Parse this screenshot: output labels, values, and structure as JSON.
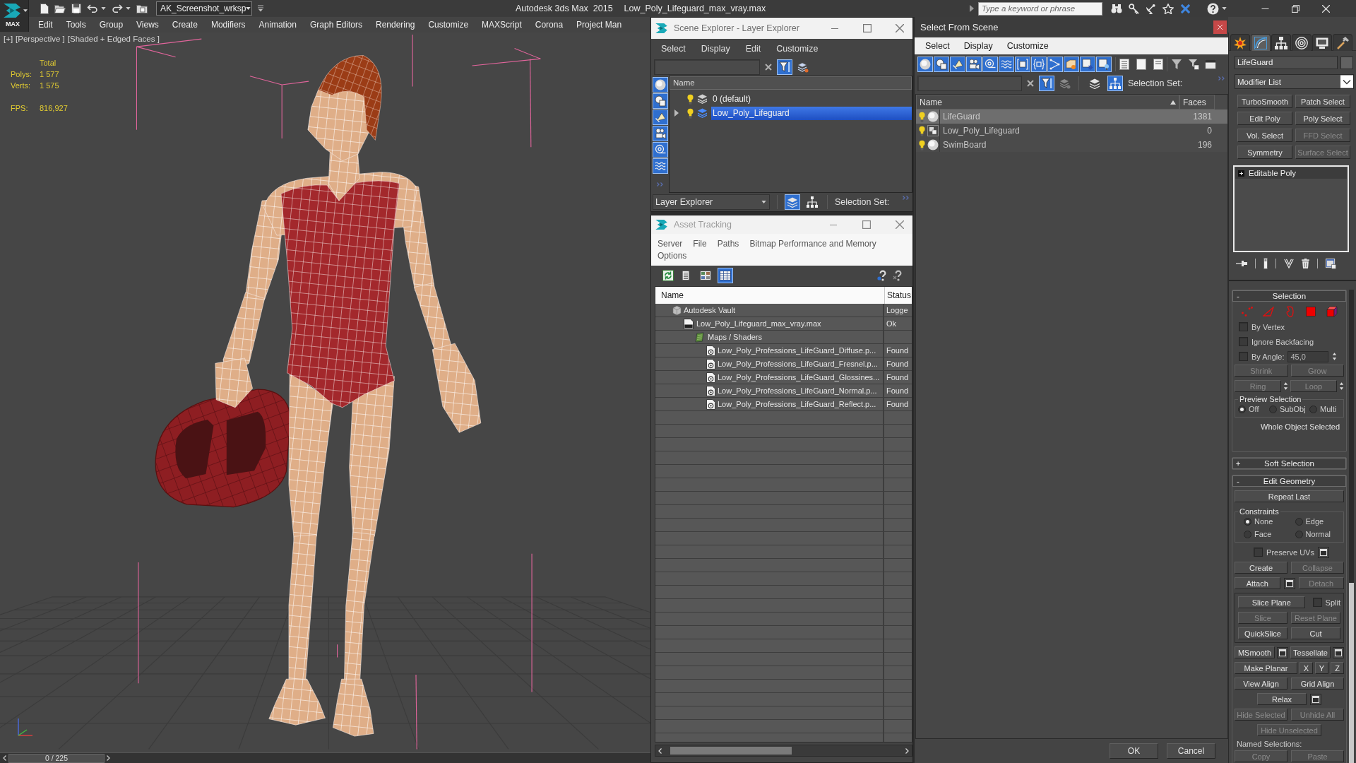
{
  "app_button": {
    "label": "MAX"
  },
  "title_bar": {
    "workspace": "AK_Screenshot_wrksp",
    "app_title": "Autodesk 3ds Max  2015",
    "file_name": "Low_Poly_Lifeguard_max_vray.max",
    "search": {
      "placeholder": "Type a keyword or phrase"
    }
  },
  "menu_bar": [
    "Edit",
    "Tools",
    "Group",
    "Views",
    "Create",
    "Modifiers",
    "Animation",
    "Graph Editors",
    "Rendering",
    "Customize",
    "MAXScript",
    "Corona",
    "Project Man"
  ],
  "viewport": {
    "labels": [
      "[+]",
      "[Perspective ]",
      "[Shaded + Edged Faces ]"
    ],
    "stats": {
      "heading": "Total",
      "rows": [
        {
          "label": "Polys:",
          "value": "1 577"
        },
        {
          "label": "Verts:",
          "value": "1 575"
        }
      ]
    },
    "fps": {
      "label": "FPS:",
      "value": "816,927"
    }
  },
  "time_slider": {
    "label": "0 / 225",
    "level": 0
  },
  "scene_explorer": {
    "title": "Scene Explorer - Layer Explorer",
    "menu": [
      "Select",
      "Display",
      "Edit",
      "Customize"
    ],
    "filter_toggle": {
      "on": true
    },
    "filters": [
      {
        "kind": "geometry",
        "on": true
      },
      {
        "kind": "shape",
        "on": true
      },
      {
        "kind": "light",
        "on": true
      },
      {
        "kind": "camera",
        "on": true
      },
      {
        "kind": "helper",
        "on": true
      },
      {
        "kind": "spacewarp",
        "on": true
      }
    ],
    "column": "Name",
    "layers": [
      {
        "name": "0 (default)",
        "visible": true,
        "selected": false,
        "expandable": false
      },
      {
        "name": "Low_Poly_Lifeguard",
        "visible": true,
        "selected": true,
        "expandable": true
      }
    ],
    "mode": "Layer Explorer",
    "views": [
      {
        "kind": "layers",
        "selected": true
      },
      {
        "kind": "hierarchy",
        "selected": false
      }
    ],
    "selection_set": "Selection Set:"
  },
  "asset_tracking": {
    "title": "Asset Tracking",
    "menu": [
      "Server",
      "File",
      "Paths",
      "Bitmap Performance and Memory",
      "Options"
    ],
    "views": [
      {
        "kind": "list",
        "selected": false
      },
      {
        "kind": "thumbnails",
        "selected": false
      },
      {
        "kind": "table",
        "selected": true
      }
    ],
    "columns": [
      "Name",
      "Status"
    ],
    "assets": [
      {
        "name": "Autodesk Vault",
        "status": "Logge",
        "kind": "vault",
        "children": [
          {
            "name": "Low_Poly_Lifeguard_max_vray.max",
            "status": "Ok",
            "kind": "scene",
            "children": [
              {
                "name": "Maps / Shaders",
                "kind": "folder",
                "children": [
                  {
                    "name": "Low_Poly_Professions_LifeGuard_Diffuse.p...",
                    "status": "Found",
                    "kind": "bitmap"
                  },
                  {
                    "name": "Low_Poly_Professions_LifeGuard_Fresnel.p...",
                    "status": "Found",
                    "kind": "bitmap"
                  },
                  {
                    "name": "Low_Poly_Professions_LifeGuard_Glossines...",
                    "status": "Found",
                    "kind": "bitmap"
                  },
                  {
                    "name": "Low_Poly_Professions_LifeGuard_Normal.p...",
                    "status": "Found",
                    "kind": "bitmap"
                  },
                  {
                    "name": "Low_Poly_Professions_LifeGuard_Reflect.p...",
                    "status": "Found",
                    "kind": "bitmap"
                  }
                ]
              }
            ]
          }
        ]
      }
    ]
  },
  "select_from_scene": {
    "title": "Select From Scene",
    "menu": [
      "Select",
      "Display",
      "Customize"
    ],
    "filters": [
      {
        "kind": "geometry",
        "on": true
      },
      {
        "kind": "shape",
        "on": true
      },
      {
        "kind": "light",
        "on": true
      },
      {
        "kind": "camera",
        "on": true
      },
      {
        "kind": "helper",
        "on": true
      },
      {
        "kind": "spacewarp",
        "on": true
      },
      {
        "kind": "group",
        "on": true
      },
      {
        "kind": "xref",
        "on": true
      },
      {
        "kind": "bone",
        "on": true
      },
      {
        "kind": "container",
        "on": true
      },
      {
        "kind": "frozen",
        "on": true
      },
      {
        "kind": "hidden",
        "on": true
      }
    ],
    "filter_toggle": {
      "on": true
    },
    "views": [
      {
        "kind": "layers",
        "selected": false
      },
      {
        "kind": "hierarchy",
        "selected": true
      }
    ],
    "selection_set": "Selection Set:",
    "columns": [
      {
        "label": "Name",
        "sorted": true
      },
      {
        "label": "Faces",
        "sorted": false
      }
    ],
    "objects": [
      {
        "name": "LifeGuard",
        "faces": "1381",
        "kind": "geometry",
        "visible": true,
        "selected": true
      },
      {
        "name": "Low_Poly_Lifeguard",
        "faces": "0",
        "kind": "group",
        "visible": true,
        "selected": false
      },
      {
        "name": "SwimBoard",
        "faces": "196",
        "kind": "geometry",
        "visible": true,
        "selected": false
      }
    ],
    "buttons": [
      "OK",
      "Cancel"
    ]
  },
  "command_panel": {
    "tabs": [
      {
        "kind": "create",
        "selected": false
      },
      {
        "kind": "modify",
        "selected": true
      },
      {
        "kind": "hierarchy",
        "selected": false
      },
      {
        "kind": "motion",
        "selected": false
      },
      {
        "kind": "display",
        "selected": false
      },
      {
        "kind": "utilities",
        "selected": false
      }
    ],
    "object_name": "LifeGuard",
    "modifier_list": "Modifier List",
    "modifier_buttons": [
      {
        "label": "TurboSmooth",
        "disabled": false
      },
      {
        "label": "Patch Select",
        "disabled": false
      },
      {
        "label": "Edit Poly",
        "disabled": false
      },
      {
        "label": "Poly Select",
        "disabled": false
      },
      {
        "label": "Vol. Select",
        "disabled": false
      },
      {
        "label": "FFD Select",
        "disabled": true
      },
      {
        "label": "Symmetry",
        "disabled": false
      },
      {
        "label": "Surface Select",
        "disabled": true
      }
    ],
    "stack": [
      {
        "name": "Editable Poly"
      }
    ],
    "selection": {
      "sign": "-",
      "title": "Selection",
      "expanded": true,
      "levels": [
        {
          "kind": "vertex",
          "selected": false
        },
        {
          "kind": "edge",
          "selected": false
        },
        {
          "kind": "border",
          "selected": false
        },
        {
          "kind": "polygon",
          "selected": false
        },
        {
          "kind": "element",
          "selected": false
        }
      ],
      "options": [
        {
          "label": "By Vertex",
          "checked": false
        },
        {
          "label": "Ignore Backfacing",
          "checked": false
        }
      ],
      "by_angle": {
        "label": "By Angle:",
        "checked": false,
        "value": "45,0"
      },
      "grow_buttons": [
        {
          "label": "Shrink",
          "disabled": true
        },
        {
          "label": "Grow",
          "disabled": true
        }
      ],
      "loop_buttons": [
        {
          "label": "Ring",
          "disabled": true
        },
        {
          "label": "Loop",
          "disabled": true
        }
      ],
      "preview": {
        "title": "Preview Selection",
        "options": [
          {
            "label": "Off",
            "selected": true
          },
          {
            "label": "SubObj",
            "selected": false
          },
          {
            "label": "Multi",
            "selected": false
          }
        ]
      },
      "status": "Whole Object Selected"
    },
    "soft_selection": {
      "sign": "+",
      "title": "Soft Selection",
      "expanded": false
    },
    "edit_geometry": {
      "sign": "-",
      "title": "Edit Geometry",
      "expanded": true,
      "sections": [
        {
          "kind": "row",
          "items": [
            {
              "kind": "button",
              "label": "Repeat Last",
              "disabled": false
            }
          ]
        },
        {
          "kind": "radio_group",
          "title": "Constraints",
          "options": [
            {
              "label": "None",
              "selected": true
            },
            {
              "label": "Edge",
              "selected": false
            },
            {
              "label": "Face",
              "selected": false
            },
            {
              "label": "Normal",
              "selected": false
            }
          ]
        },
        {
          "kind": "center_row",
          "items": [
            {
              "kind": "checkbox",
              "label": "Preserve UVs",
              "checked": false
            },
            {
              "kind": "settings"
            }
          ]
        },
        {
          "kind": "row",
          "items": [
            {
              "kind": "button",
              "label": "Create",
              "disabled": false
            },
            {
              "kind": "button",
              "label": "Collapse",
              "disabled": true
            }
          ]
        },
        {
          "kind": "row",
          "items": [
            {
              "kind": "button",
              "label": "Attach",
              "disabled": false
            },
            {
              "kind": "settings"
            },
            {
              "kind": "button",
              "label": "Detach",
              "disabled": true
            }
          ]
        },
        {
          "kind": "frame",
          "rows": [
            {
              "items": [
                {
                  "kind": "button",
                  "label": "Slice Plane",
                  "disabled": false
                },
                {
                  "kind": "checkbox",
                  "label": "Split",
                  "checked": false
                }
              ]
            },
            {
              "items": [
                {
                  "kind": "button",
                  "label": "Slice",
                  "disabled": true
                },
                {
                  "kind": "button",
                  "label": "Reset Plane",
                  "disabled": true
                }
              ]
            },
            {
              "items": [
                {
                  "kind": "button",
                  "label": "QuickSlice",
                  "disabled": false
                },
                {
                  "kind": "button",
                  "label": "Cut",
                  "disabled": false
                }
              ]
            }
          ]
        },
        {
          "kind": "row",
          "items": [
            {
              "kind": "button",
              "label": "MSmooth",
              "disabled": false
            },
            {
              "kind": "settings"
            },
            {
              "kind": "button",
              "label": "Tessellate",
              "disabled": false
            },
            {
              "kind": "settings"
            }
          ]
        },
        {
          "kind": "row",
          "items": [
            {
              "kind": "button",
              "label": "Make Planar",
              "disabled": false
            },
            {
              "kind": "axis",
              "label": "X",
              "disabled": false
            },
            {
              "kind": "axis",
              "label": "Y",
              "disabled": false
            },
            {
              "kind": "axis",
              "label": "Z",
              "disabled": false
            }
          ]
        },
        {
          "kind": "row",
          "items": [
            {
              "kind": "button",
              "label": "View Align",
              "disabled": false
            },
            {
              "kind": "button",
              "label": "Grid Align",
              "disabled": false
            }
          ]
        },
        {
          "kind": "center_row",
          "items": [
            {
              "kind": "button",
              "label": "Relax",
              "disabled": false
            },
            {
              "kind": "settings"
            }
          ]
        },
        {
          "kind": "row",
          "items": [
            {
              "kind": "button",
              "label": "Hide Selected",
              "disabled": true
            },
            {
              "kind": "button",
              "label": "Unhide All",
              "disabled": true
            }
          ]
        },
        {
          "kind": "center_row",
          "items": [
            {
              "kind": "button",
              "label": "Hide Unselected",
              "disabled": true
            }
          ]
        },
        {
          "kind": "label",
          "text": "Named Selections:"
        },
        {
          "kind": "row",
          "items": [
            {
              "kind": "button",
              "label": "Copy",
              "disabled": true
            },
            {
              "kind": "button",
              "label": "Paste",
              "disabled": true
            }
          ]
        }
      ]
    }
  }
}
